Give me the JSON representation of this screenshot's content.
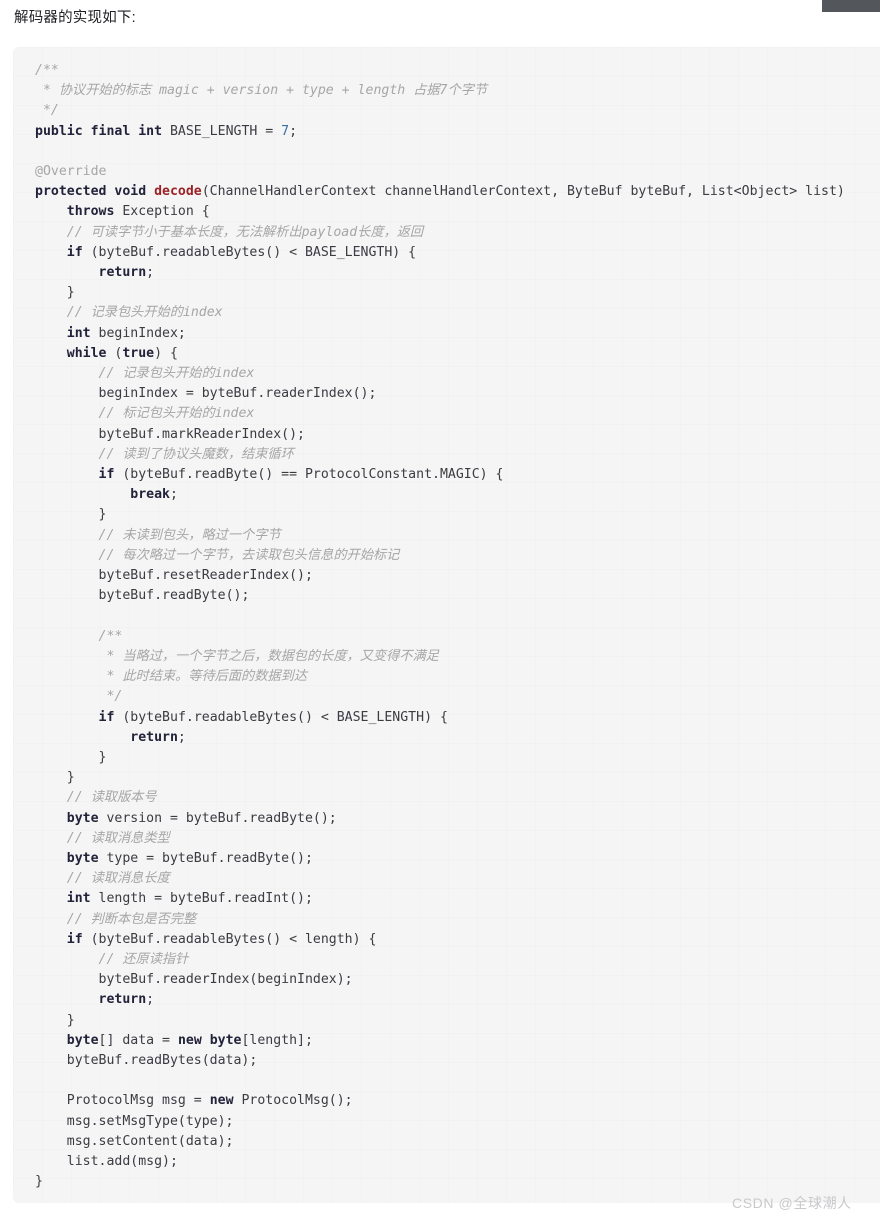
{
  "page": {
    "intro_text": "解码器的实现如下:",
    "watermark": "CSDN @全球潮人",
    "accent_keyword_color": "#22223a",
    "accent_method_color": "#9b2226",
    "accent_number_color": "#3a6ea5",
    "comment_color": "#a6a6a6",
    "code_background_color": "#f5f5f5",
    "page_background_color": "#ffffff",
    "artifact_bar_color": "#53565b"
  },
  "code_block": {
    "language": "java",
    "lines": [
      {
        "indent": 0,
        "tokens": [
          {
            "t": "cmt",
            "s": "/**"
          }
        ]
      },
      {
        "indent": 0,
        "tokens": [
          {
            "t": "cmt",
            "s": " * 协议开始的标志 magic + version + type + length 占据7个字节"
          }
        ]
      },
      {
        "indent": 0,
        "tokens": [
          {
            "t": "cmt",
            "s": " */"
          }
        ]
      },
      {
        "indent": 0,
        "tokens": [
          {
            "t": "kw",
            "s": "public final int"
          },
          {
            "t": "pln",
            "s": " BASE_LENGTH = "
          },
          {
            "t": "num",
            "s": "7"
          },
          {
            "t": "pln",
            "s": ";"
          }
        ]
      },
      {
        "indent": 0,
        "tokens": []
      },
      {
        "indent": 0,
        "tokens": [
          {
            "t": "ann",
            "s": "@Override"
          }
        ]
      },
      {
        "indent": 0,
        "tokens": [
          {
            "t": "kw",
            "s": "protected void "
          },
          {
            "t": "fn",
            "s": "decode"
          },
          {
            "t": "pln",
            "s": "(ChannelHandlerContext channelHandlerContext, ByteBuf byteBuf, List<Object> list)"
          }
        ]
      },
      {
        "indent": 1,
        "tokens": [
          {
            "t": "kw",
            "s": "throws"
          },
          {
            "t": "pln",
            "s": " Exception {"
          }
        ]
      },
      {
        "indent": 1,
        "tokens": [
          {
            "t": "cmt",
            "s": "// 可读字节小于基本长度，无法解析出payload长度，返回"
          }
        ]
      },
      {
        "indent": 1,
        "tokens": [
          {
            "t": "kw",
            "s": "if"
          },
          {
            "t": "pln",
            "s": " (byteBuf.readableBytes() < BASE_LENGTH) {"
          }
        ]
      },
      {
        "indent": 2,
        "tokens": [
          {
            "t": "kw",
            "s": "return"
          },
          {
            "t": "pln",
            "s": ";"
          }
        ]
      },
      {
        "indent": 1,
        "tokens": [
          {
            "t": "pln",
            "s": "}"
          }
        ]
      },
      {
        "indent": 1,
        "tokens": [
          {
            "t": "cmt",
            "s": "// 记录包头开始的index"
          }
        ]
      },
      {
        "indent": 1,
        "tokens": [
          {
            "t": "kw",
            "s": "int"
          },
          {
            "t": "pln",
            "s": " beginIndex;"
          }
        ]
      },
      {
        "indent": 1,
        "tokens": [
          {
            "t": "kw",
            "s": "while"
          },
          {
            "t": "pln",
            "s": " ("
          },
          {
            "t": "kw",
            "s": "true"
          },
          {
            "t": "pln",
            "s": ") {"
          }
        ]
      },
      {
        "indent": 2,
        "tokens": [
          {
            "t": "cmt",
            "s": "// 记录包头开始的index"
          }
        ]
      },
      {
        "indent": 2,
        "tokens": [
          {
            "t": "pln",
            "s": "beginIndex = byteBuf.readerIndex();"
          }
        ]
      },
      {
        "indent": 2,
        "tokens": [
          {
            "t": "cmt",
            "s": "// 标记包头开始的index"
          }
        ]
      },
      {
        "indent": 2,
        "tokens": [
          {
            "t": "pln",
            "s": "byteBuf.markReaderIndex();"
          }
        ]
      },
      {
        "indent": 2,
        "tokens": [
          {
            "t": "cmt",
            "s": "// 读到了协议头魔数，结束循环"
          }
        ]
      },
      {
        "indent": 2,
        "tokens": [
          {
            "t": "kw",
            "s": "if"
          },
          {
            "t": "pln",
            "s": " (byteBuf.readByte() == ProtocolConstant.MAGIC) {"
          }
        ]
      },
      {
        "indent": 3,
        "tokens": [
          {
            "t": "kw",
            "s": "break"
          },
          {
            "t": "pln",
            "s": ";"
          }
        ]
      },
      {
        "indent": 2,
        "tokens": [
          {
            "t": "pln",
            "s": "}"
          }
        ]
      },
      {
        "indent": 2,
        "tokens": [
          {
            "t": "cmt",
            "s": "// 未读到包头，略过一个字节"
          }
        ]
      },
      {
        "indent": 2,
        "tokens": [
          {
            "t": "cmt",
            "s": "// 每次略过一个字节，去读取包头信息的开始标记"
          }
        ]
      },
      {
        "indent": 2,
        "tokens": [
          {
            "t": "pln",
            "s": "byteBuf.resetReaderIndex();"
          }
        ]
      },
      {
        "indent": 2,
        "tokens": [
          {
            "t": "pln",
            "s": "byteBuf.readByte();"
          }
        ]
      },
      {
        "indent": 0,
        "tokens": []
      },
      {
        "indent": 2,
        "tokens": [
          {
            "t": "cmt",
            "s": "/**"
          }
        ]
      },
      {
        "indent": 2,
        "tokens": [
          {
            "t": "cmt",
            "s": " * 当略过，一个字节之后，数据包的长度，又变得不满足"
          }
        ]
      },
      {
        "indent": 2,
        "tokens": [
          {
            "t": "cmt",
            "s": " * 此时结束。等待后面的数据到达"
          }
        ]
      },
      {
        "indent": 2,
        "tokens": [
          {
            "t": "cmt",
            "s": " */"
          }
        ]
      },
      {
        "indent": 2,
        "tokens": [
          {
            "t": "kw",
            "s": "if"
          },
          {
            "t": "pln",
            "s": " (byteBuf.readableBytes() < BASE_LENGTH) {"
          }
        ]
      },
      {
        "indent": 3,
        "tokens": [
          {
            "t": "kw",
            "s": "return"
          },
          {
            "t": "pln",
            "s": ";"
          }
        ]
      },
      {
        "indent": 2,
        "tokens": [
          {
            "t": "pln",
            "s": "}"
          }
        ]
      },
      {
        "indent": 1,
        "tokens": [
          {
            "t": "pln",
            "s": "}"
          }
        ]
      },
      {
        "indent": 1,
        "tokens": [
          {
            "t": "cmt",
            "s": "// 读取版本号"
          }
        ]
      },
      {
        "indent": 1,
        "tokens": [
          {
            "t": "kw",
            "s": "byte"
          },
          {
            "t": "pln",
            "s": " version = byteBuf.readByte();"
          }
        ]
      },
      {
        "indent": 1,
        "tokens": [
          {
            "t": "cmt",
            "s": "// 读取消息类型"
          }
        ]
      },
      {
        "indent": 1,
        "tokens": [
          {
            "t": "kw",
            "s": "byte"
          },
          {
            "t": "pln",
            "s": " type = byteBuf.readByte();"
          }
        ]
      },
      {
        "indent": 1,
        "tokens": [
          {
            "t": "cmt",
            "s": "// 读取消息长度"
          }
        ]
      },
      {
        "indent": 1,
        "tokens": [
          {
            "t": "kw",
            "s": "int"
          },
          {
            "t": "pln",
            "s": " length = byteBuf.readInt();"
          }
        ]
      },
      {
        "indent": 1,
        "tokens": [
          {
            "t": "cmt",
            "s": "// 判断本包是否完整"
          }
        ]
      },
      {
        "indent": 1,
        "tokens": [
          {
            "t": "kw",
            "s": "if"
          },
          {
            "t": "pln",
            "s": " (byteBuf.readableBytes() < length) {"
          }
        ]
      },
      {
        "indent": 2,
        "tokens": [
          {
            "t": "cmt",
            "s": "// 还原读指针"
          }
        ]
      },
      {
        "indent": 2,
        "tokens": [
          {
            "t": "pln",
            "s": "byteBuf.readerIndex(beginIndex);"
          }
        ]
      },
      {
        "indent": 2,
        "tokens": [
          {
            "t": "kw",
            "s": "return"
          },
          {
            "t": "pln",
            "s": ";"
          }
        ]
      },
      {
        "indent": 1,
        "tokens": [
          {
            "t": "pln",
            "s": "}"
          }
        ]
      },
      {
        "indent": 1,
        "tokens": [
          {
            "t": "kw",
            "s": "byte"
          },
          {
            "t": "pln",
            "s": "[] data = "
          },
          {
            "t": "kw",
            "s": "new byte"
          },
          {
            "t": "pln",
            "s": "[length];"
          }
        ]
      },
      {
        "indent": 1,
        "tokens": [
          {
            "t": "pln",
            "s": "byteBuf.readBytes(data);"
          }
        ]
      },
      {
        "indent": 0,
        "tokens": []
      },
      {
        "indent": 1,
        "tokens": [
          {
            "t": "pln",
            "s": "ProtocolMsg msg = "
          },
          {
            "t": "kw",
            "s": "new"
          },
          {
            "t": "pln",
            "s": " ProtocolMsg();"
          }
        ]
      },
      {
        "indent": 1,
        "tokens": [
          {
            "t": "pln",
            "s": "msg.setMsgType(type);"
          }
        ]
      },
      {
        "indent": 1,
        "tokens": [
          {
            "t": "pln",
            "s": "msg.setContent(data);"
          }
        ]
      },
      {
        "indent": 1,
        "tokens": [
          {
            "t": "pln",
            "s": "list.add(msg);"
          }
        ]
      },
      {
        "indent": 0,
        "tokens": [
          {
            "t": "pln",
            "s": "}"
          }
        ]
      }
    ]
  }
}
